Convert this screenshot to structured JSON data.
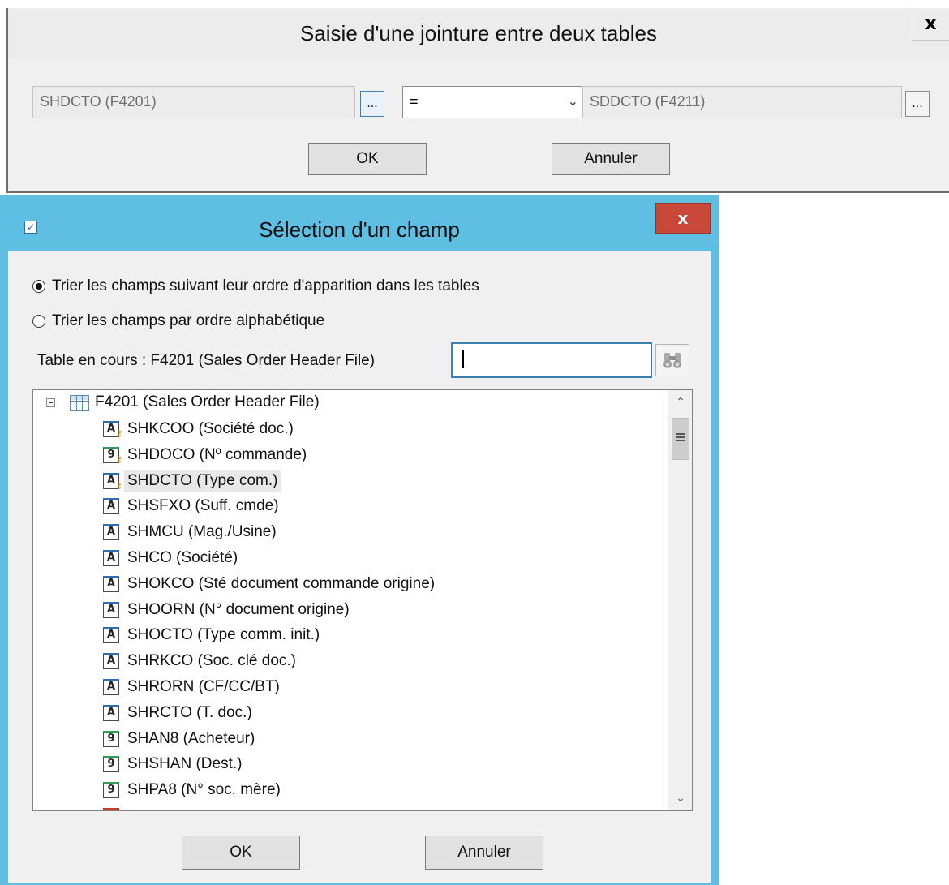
{
  "join_dialog": {
    "title": "Saisie d'une jointure entre deux tables",
    "close_label": "x",
    "left_field": "SHDCTO (F4201)",
    "right_field": "SDDCTO (F4211)",
    "browse_label": "...",
    "operator": "=",
    "ok_label": "OK",
    "cancel_label": "Annuler"
  },
  "field_dialog": {
    "title": "Sélection d'un champ",
    "close_label": "x",
    "sort_order_label": "Trier les champs suivant leur ordre d'apparition dans les tables",
    "sort_alpha_label": "Trier les champs par ordre alphabétique",
    "sort_selected": "order",
    "current_table_label": "Table en cours :  F4201 (Sales Order Header File)",
    "search_value": "",
    "tree": {
      "root_label": "F4201 (Sales Order Header File)",
      "expanded": true,
      "items": [
        {
          "label": "SHKCOO (Société doc.)",
          "icon": "alpha-key-field-icon",
          "glyph": "A",
          "key": true,
          "selected": false
        },
        {
          "label": "SHDOCO (Nº commande)",
          "icon": "numeric-key-field-icon",
          "glyph": "9",
          "key": true,
          "selected": false
        },
        {
          "label": "SHDCTO (Type com.)",
          "icon": "alpha-key-field-icon",
          "glyph": "A",
          "key": true,
          "selected": true
        },
        {
          "label": "SHSFXO (Suff. cmde)",
          "icon": "alpha-field-icon",
          "glyph": "A",
          "key": false,
          "selected": false
        },
        {
          "label": "SHMCU (Mag./Usine)",
          "icon": "alpha-field-icon",
          "glyph": "A",
          "key": false,
          "selected": false
        },
        {
          "label": "SHCO (Société)",
          "icon": "alpha-field-icon",
          "glyph": "A",
          "key": false,
          "selected": false
        },
        {
          "label": "SHOKCO (Sté document commande origine)",
          "icon": "alpha-field-icon",
          "glyph": "A",
          "key": false,
          "selected": false
        },
        {
          "label": "SHOORN (N° document origine)",
          "icon": "alpha-field-icon",
          "glyph": "A",
          "key": false,
          "selected": false
        },
        {
          "label": "SHOCTO (Type comm. init.)",
          "icon": "alpha-field-icon",
          "glyph": "A",
          "key": false,
          "selected": false
        },
        {
          "label": "SHRKCO (Soc. clé doc.)",
          "icon": "alpha-field-icon",
          "glyph": "A",
          "key": false,
          "selected": false
        },
        {
          "label": "SHRORN (CF/CC/BT)",
          "icon": "alpha-field-icon",
          "glyph": "A",
          "key": false,
          "selected": false
        },
        {
          "label": "SHRCTO (T. doc.)",
          "icon": "alpha-field-icon",
          "glyph": "A",
          "key": false,
          "selected": false
        },
        {
          "label": "SHAN8 (Acheteur)",
          "icon": "numeric-field-icon",
          "glyph": "9",
          "key": false,
          "selected": false
        },
        {
          "label": "SHSHAN (Dest.)",
          "icon": "numeric-field-icon",
          "glyph": "9",
          "key": false,
          "selected": false
        },
        {
          "label": "SHPA8 (N° soc. mère)",
          "icon": "numeric-field-icon",
          "glyph": "9",
          "key": false,
          "selected": false
        }
      ]
    },
    "ok_label": "OK",
    "cancel_label": "Annuler"
  },
  "colors": {
    "dialog_frame": "#5fbfe3",
    "close_button": "#c9483a",
    "alpha_field": "#2f6db3",
    "numeric_field": "#2e9d5a"
  }
}
